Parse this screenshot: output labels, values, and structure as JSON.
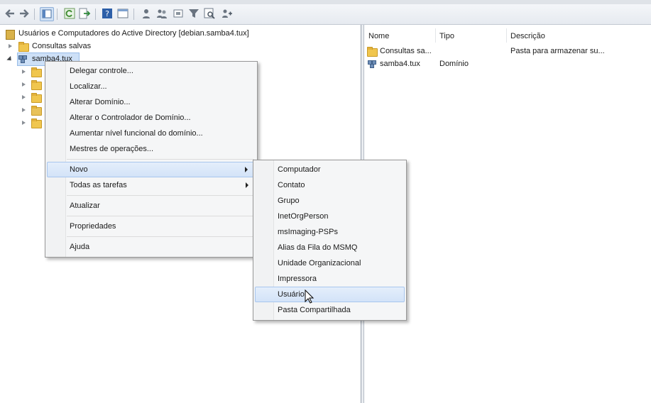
{
  "tree": {
    "root_label": "Usuários e Computadores do Active Directory [debian.samba4.tux]",
    "saved_queries_label": "Consultas salvas",
    "domain_label": "samba4.tux"
  },
  "list": {
    "headers": {
      "name": "Nome",
      "type": "Tipo",
      "description": "Descrição"
    },
    "rows": [
      {
        "name": "Consultas sa...",
        "type": "",
        "description": "Pasta para armazenar su..."
      },
      {
        "name": "samba4.tux",
        "type": "Domínio",
        "description": ""
      }
    ]
  },
  "context_menu": {
    "delegate": "Delegar controle...",
    "find": "Localizar...",
    "change_domain": "Alterar Domínio...",
    "change_dc": "Alterar o Controlador de Domínio...",
    "raise_level": "Aumentar nível funcional do domínio...",
    "operations_masters": "Mestres de operações...",
    "new": "Novo",
    "all_tasks": "Todas as tarefas",
    "refresh": "Atualizar",
    "properties": "Propriedades",
    "help": "Ajuda"
  },
  "submenu": {
    "computer": "Computador",
    "contact": "Contato",
    "group": "Grupo",
    "inetorgperson": "InetOrgPerson",
    "msimaging": "msImaging-PSPs",
    "msmq_alias": "Alias da Fila do MSMQ",
    "ou": "Unidade Organizacional",
    "printer": "Impressora",
    "user": "Usuário",
    "shared_folder": "Pasta Compartilhada"
  },
  "colors": {
    "highlight": "#d3e3f8",
    "highlight_border": "#a8c6ee",
    "folder": "#f0c64e"
  }
}
